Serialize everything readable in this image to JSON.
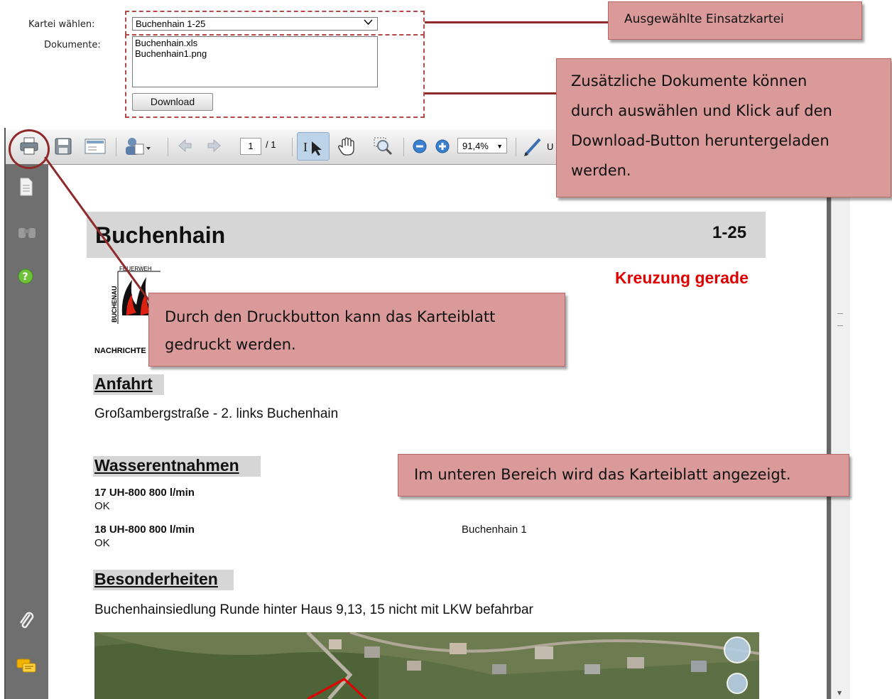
{
  "form": {
    "kartei_label": "Kartei wählen:",
    "kartei_value": "Buchenhain 1-25",
    "dokumente_label": "Dokumente:",
    "documents": [
      "Buchenhain.xls",
      "Buchenhain1.png"
    ],
    "download_label": "Download"
  },
  "toolbar": {
    "page_current": "1",
    "page_total": "/ 1",
    "zoom": "91,4%",
    "cut_text": "U"
  },
  "doc": {
    "title": "Buchenhain",
    "code": "1-25",
    "kreuzung": "Kreuzung gerade",
    "logo_top": "FEUERWEHR",
    "logo_side": "BUCHENAU",
    "nachrichten": "NACHRICHTE",
    "anfahrt_heading": "Anfahrt",
    "anfahrt_text": "Großambergstraße - 2. links Buchenhain",
    "wasser_heading": "Wasserentnahmen",
    "wasser": [
      {
        "name": "17 UH-800 800 l/min",
        "status": "OK"
      },
      {
        "name": "18 UH-800 800 l/min",
        "status": "OK"
      }
    ],
    "buchenhain1": "Buchenhain 1",
    "besonder_heading": "Besonderheiten",
    "besonder_text": "Buchenhainsiedlung Runde hinter Haus 9,13, 15 nicht mit LKW befahrbar"
  },
  "callouts": {
    "einsatzkartei": "Ausgewählte Einsatzkartei",
    "dokumente_1": "Zusätzliche Dokumente können",
    "dokumente_2": "durch auswählen und Klick auf den",
    "dokumente_3": "Download-Button heruntergeladen",
    "dokumente_4": "werden.",
    "druck_1": "Durch den Druckbutton kann das Karteiblatt",
    "druck_2": "gedruckt werden.",
    "unten": "Im unteren Bereich wird das Karteiblatt angezeigt."
  },
  "colors": {
    "callout_fill": "#d99a99",
    "connector": "#8e2a2a",
    "accent_red": "#e00000"
  }
}
